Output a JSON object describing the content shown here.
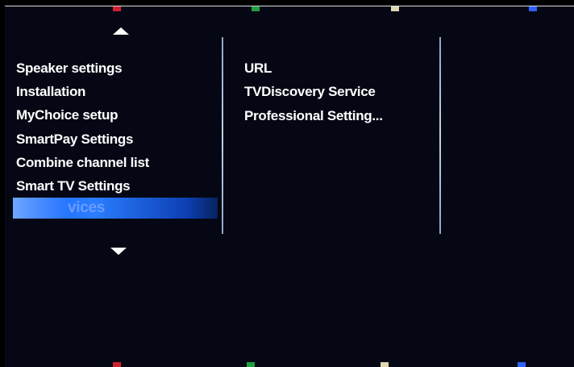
{
  "menu": {
    "items": [
      {
        "label": "Speaker settings"
      },
      {
        "label": "Installation"
      },
      {
        "label": "MyChoice setup"
      },
      {
        "label": "SmartPay Settings"
      },
      {
        "label": "Combine channel list"
      },
      {
        "label": "Smart TV Settings"
      },
      {
        "label": "vices"
      }
    ]
  },
  "submenu": {
    "items": [
      {
        "label": "URL"
      },
      {
        "label": "TVDiscovery Service"
      },
      {
        "label": "Professional Setting..."
      }
    ]
  },
  "colors": {
    "background": "#050814",
    "highlight": "#1a66ff",
    "key_red": "#d02030",
    "key_green": "#20a040",
    "key_yellow": "#e0d8b0",
    "key_blue": "#3060ff"
  }
}
